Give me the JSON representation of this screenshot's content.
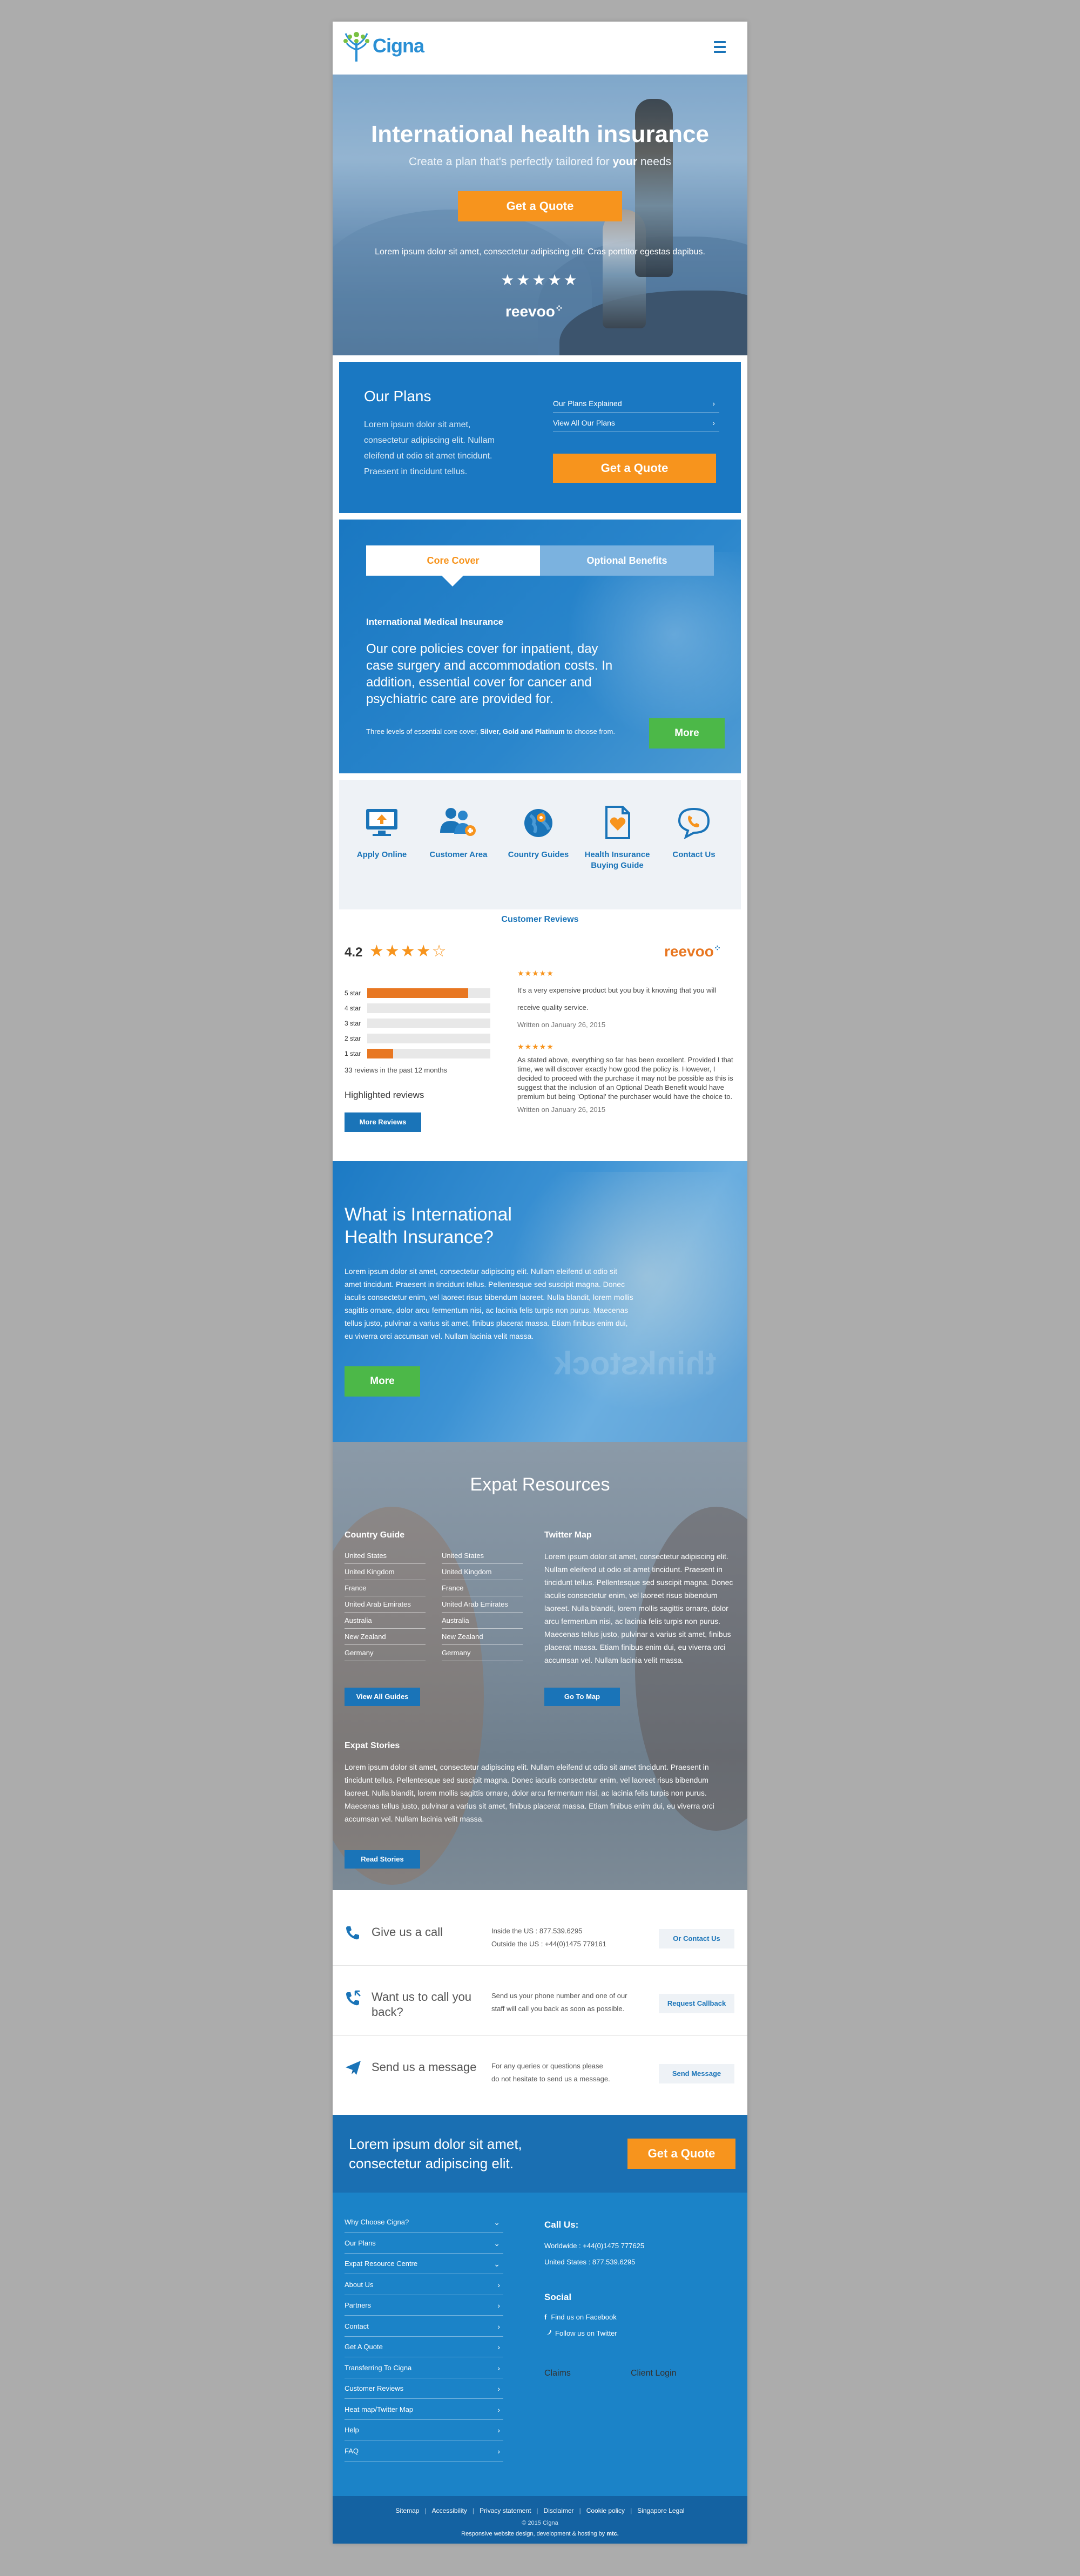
{
  "brand": {
    "name": "Cigna",
    "color": "#2a8fd4",
    "accent": "#f7941d"
  },
  "hero": {
    "title": "International health insurance",
    "subtitle_pre": "Create a plan that's perfectly tailored for ",
    "subtitle_bold": "your",
    "subtitle_post": " needs",
    "cta": "Get a Quote",
    "lorem": "Lorem ipsum dolor sit amet, consectetur adipiscing elit. Cras porttitor egestas dapibus.",
    "stars": "★★★★★",
    "provider": "reevoo"
  },
  "plans": {
    "title": "Our Plans",
    "text": "Lorem ipsum dolor sit amet, consectetur adipiscing elit. Nullam eleifend ut odio sit amet tincidunt. Praesent in tincidunt tellus.",
    "links": [
      "Our Plans Explained",
      "View All Our Plans"
    ],
    "cta": "Get a Quote"
  },
  "cover": {
    "tabs": [
      "Core Cover",
      "Optional Benefits"
    ],
    "heading": "International Medical Insurance",
    "body": "Our core policies cover for inpatient, day case surgery and accommodation costs. In addition, essential cover for cancer and psychiatric care are provided for.",
    "levels_pre": "Three levels of essential core cover, ",
    "levels_bold": "Silver, Gold and Platinum",
    "levels_post": " to choose from.",
    "more": "More"
  },
  "quicklinks": [
    {
      "label": "Apply Online",
      "icon": "monitor-upload-icon"
    },
    {
      "label": "Customer Area",
      "icon": "users-plus-icon"
    },
    {
      "label": "Country Guides",
      "icon": "globe-pin-icon"
    },
    {
      "label": "Health Insurance Buying Guide",
      "icon": "heart-document-icon"
    },
    {
      "label": "Contact Us",
      "icon": "phone-bubble-icon"
    }
  ],
  "reviews": {
    "title": "Customer Reviews",
    "rating": "4.2",
    "rating_value": 4.2,
    "provider": "reevoo",
    "bars": [
      {
        "label": "5 star",
        "fraction": 0.82
      },
      {
        "label": "4 star",
        "fraction": 0
      },
      {
        "label": "3 star",
        "fraction": 0
      },
      {
        "label": "2 star",
        "fraction": 0
      },
      {
        "label": "1 star",
        "fraction": 0.21
      }
    ],
    "count_text": "33 reviews in the past 12 months",
    "highlighted": "Highlighted reviews",
    "more": "More Reviews",
    "items": [
      {
        "stars": "★★★★★",
        "text": "It's a very expensive product but you buy it knowing that you will receive quality service.",
        "date": "Written on January 26, 2015"
      },
      {
        "stars": "★★★★★",
        "text": "As stated above, everything so far has been excellent. Provided I that time, we will discover exactly how good the policy is. However, I decided to proceed with the purchase it may not be possible as this is suggest that the inclusion of an Optional Death Benefit would have premium but being 'Optional' the purchaser would have the choice to.",
        "date": "Written on January 26, 2015"
      }
    ]
  },
  "whatis": {
    "title": "What is International Health Insurance?",
    "text": "Lorem ipsum dolor sit amet, consectetur adipiscing elit. Nullam eleifend ut odio sit amet tincidunt. Praesent in tincidunt tellus. Pellentesque sed suscipit magna. Donec iaculis consectetur enim, vel laoreet risus bibendum laoreet. Nulla blandit, lorem mollis sagittis ornare, dolor arcu fermentum nisi, ac lacinia felis turpis non purus. Maecenas tellus justo, pulvinar a varius sit amet, finibus placerat massa. Etiam finibus enim dui, eu viverra orci accumsan vel. Nullam lacinia velit massa.",
    "more": "More",
    "watermark": "thinkstock"
  },
  "expat": {
    "title": "Expat Resources",
    "guide_title": "Country Guide",
    "guide_col1": [
      "United States",
      "United Kingdom",
      "France",
      "United Arab Emirates",
      "Australia",
      "New Zealand",
      "Germany"
    ],
    "guide_col2": [
      "United States",
      "United Kingdom",
      "France",
      "United Arab Emirates",
      "Australia",
      "New Zealand",
      "Germany"
    ],
    "guide_btn": "View All Guides",
    "twitter_title": "Twitter Map",
    "twitter_text": "Lorem ipsum dolor sit amet, consectetur adipiscing elit. Nullam eleifend ut odio sit amet tincidunt. Praesent in tincidunt tellus. Pellentesque sed suscipit magna. Donec iaculis consectetur enim, vel laoreet risus bibendum laoreet. Nulla blandit, lorem mollis sagittis ornare, dolor arcu fermentum nisi, ac lacinia felis turpis non purus. Maecenas tellus justo, pulvinar a varius sit amet, finibus placerat massa. Etiam finibus enim dui, eu viverra orci accumsan vel. Nullam lacinia velit massa.",
    "twitter_btn": "Go To Map",
    "stories_title": "Expat Stories",
    "stories_text": "Lorem ipsum dolor sit amet, consectetur adipiscing elit. Nullam eleifend ut odio sit amet tincidunt. Praesent in tincidunt tellus. Pellentesque sed suscipit magna. Donec iaculis consectetur enim, vel laoreet risus bibendum laoreet. Nulla blandit, lorem mollis sagittis ornare, dolor arcu fermentum nisi, ac lacinia felis turpis non purus. Maecenas tellus justo, pulvinar a varius sit amet, finibus placerat massa. Etiam finibus enim dui, eu viverra orci accumsan vel. Nullam lacinia velit massa.",
    "stories_btn": "Read Stories"
  },
  "contact": [
    {
      "title": "Give us a call",
      "lines": [
        "Inside the US : 877.539.6295",
        "Outside the US : +44(0)1475 779161"
      ],
      "button": "Or Contact Us",
      "icon": "phone-icon"
    },
    {
      "title": "Want us to call you back?",
      "lines": [
        "Send us your phone number and one of our",
        "staff will call you back as soon as possible."
      ],
      "button": "Request Callback",
      "icon": "phone-callback-icon"
    },
    {
      "title": "Send us a message",
      "lines": [
        "For any queries or questions please",
        "do not hesitate to send us a message."
      ],
      "button": "Send Message",
      "icon": "paper-plane-icon"
    }
  ],
  "footer_quote": {
    "text": "Lorem ipsum dolor sit amet, consectetur adipiscing elit.",
    "cta": "Get a Quote"
  },
  "footer": {
    "links": [
      "Why Choose Cigna?",
      "Our Plans",
      "Expat Resource Centre",
      "About Us",
      "Partners",
      "Contact",
      "Get A Quote",
      "Transferring To Cigna",
      "Customer Reviews",
      "Heat map/Twitter Map",
      "Help",
      "FAQ"
    ],
    "expand": [
      true,
      true,
      true,
      false,
      false,
      false,
      false,
      false,
      false,
      false,
      false,
      false
    ],
    "call_title": "Call Us:",
    "call_lines": [
      "Worldwide : +44(0)1475 777625",
      "United States : 877.539.6295"
    ],
    "social_title": "Social",
    "social": [
      "Find us on Facebook",
      "Follow us on Twitter"
    ],
    "buttons": [
      "Claims",
      "Client Login"
    ]
  },
  "bottom": {
    "links": [
      "Sitemap",
      "Accessibility",
      "Privacy statement",
      "Disclaimer",
      "Cookie policy",
      "Singapore Legal"
    ],
    "copyright": "© 2015 Cigna",
    "credit_pre": "Responsive website design, development & hosting by ",
    "credit_bold": "mtc."
  }
}
